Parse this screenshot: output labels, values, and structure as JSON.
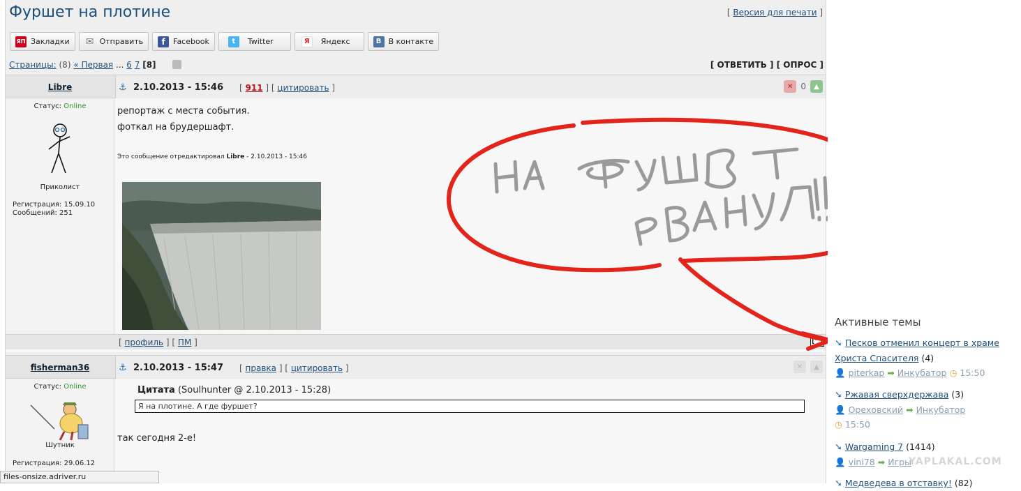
{
  "title": "Фуршет на плотине",
  "print_link": "Версия для печати",
  "share": [
    {
      "label": "Закладки",
      "icon": "yap-icon",
      "glyph": "ЯП",
      "color": "#d0021b"
    },
    {
      "label": "Отправить",
      "icon": "envelope-icon",
      "glyph": "✉",
      "color": "#888888"
    },
    {
      "label": "Facebook",
      "icon": "facebook-icon",
      "glyph": "f",
      "color": "#3b5998"
    },
    {
      "label": "Twitter",
      "icon": "twitter-icon",
      "glyph": "t",
      "color": "#4ab3f4"
    },
    {
      "label": "Яндекс",
      "icon": "yandex-icon",
      "glyph": "Я",
      "color": "#e02020"
    },
    {
      "label": "В контакте",
      "icon": "vk-icon",
      "glyph": "B",
      "color": "#4c75a3"
    }
  ],
  "pager": {
    "label": "Страницы:",
    "count": "(8)",
    "first": "« Первая",
    "dots": "...",
    "pages": [
      "6",
      "7"
    ],
    "current": "[8]"
  },
  "reply": "[ ОТВЕТИТЬ ] [ ОПРОС ]",
  "posts": [
    {
      "author": "Libre",
      "status_label": "Статус:",
      "status": "Online",
      "rank": "Приколист",
      "reg": "Регистрация: 15.09.10",
      "msgs": "Сообщений: 251",
      "date": "2.10.2013 - 15:46",
      "num": "911",
      "quote_btn": "цитировать",
      "vote": "0",
      "lines": [
        "репортаж с места события.",
        "фоткал на брудершафт."
      ],
      "edited_prefix": "Это сообщение отредактировал",
      "edited_by": "Libre",
      "edited_at": "- 2.10.2013 - 15:46",
      "profile": "профиль",
      "pm": "ПМ",
      "up": "[^]"
    },
    {
      "author": "fisherman36",
      "status_label": "Статус:",
      "status": "Online",
      "rank": "Шутник",
      "reg": "Регистрация: 29.06.12",
      "date": "2.10.2013 - 15:47",
      "edit_btn": "правка",
      "quote_btn": "цитировать",
      "quote_label": "Цитата",
      "quote_src": "(Soulhunter @ 2.10.2013 - 15:28)",
      "quote_text": "Я на плотине. А где фуршет?",
      "text": "так сегодня 2-е!"
    }
  ],
  "drawing": {
    "line1": "НА ФУРШЕТ",
    "line2": "РВАНУЛ!!!",
    "color": "#e3241b"
  },
  "active": {
    "title": "Активные темы",
    "topics": [
      {
        "title": "Песков отменил концерт в храме",
        "title2": "Христа Спасителя",
        "count": "(4)",
        "user": "piterkap",
        "section": "Инкубатор",
        "time": "15:50"
      },
      {
        "title": "Ржавая сверхдержава",
        "count": "(3)",
        "user": "Ореховский",
        "section": "Инкубатор",
        "time": "15:50"
      },
      {
        "title": "Wargaming 7",
        "count": "(1414)",
        "user": "vini78",
        "section": "Игры"
      },
      {
        "title": "Медведева в отставку!",
        "count": "(82)"
      }
    ]
  },
  "statusbar": "files-onsize.adriver.ru",
  "watermark": "YAPLAKAL.COM"
}
